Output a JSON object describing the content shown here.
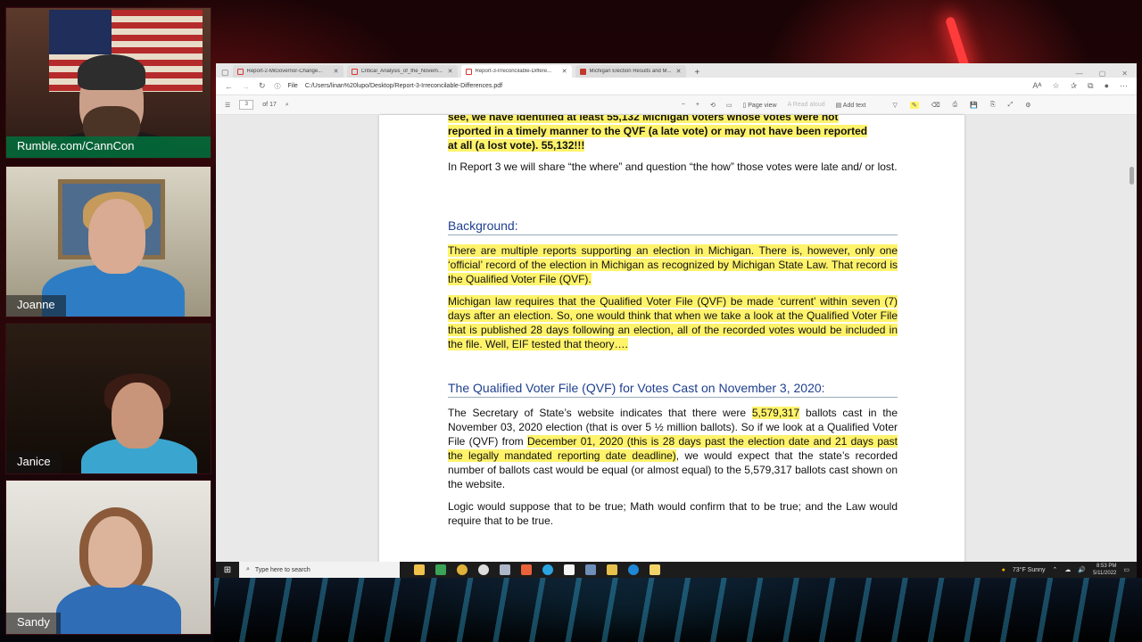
{
  "webcams": [
    {
      "name": "Rumble.com/CannCon"
    },
    {
      "name": "Joanne"
    },
    {
      "name": "Janice"
    },
    {
      "name": "Sandy"
    }
  ],
  "browser": {
    "tabs": [
      {
        "title": "Report-2-MiGovernor-Change..."
      },
      {
        "title": "Critical_Analysis_of_the_Novem..."
      },
      {
        "title": "Report-3-Irreconcilable-Differe..."
      },
      {
        "title": "Michigan Election Results and M..."
      }
    ],
    "address": {
      "file_label": "File",
      "url": "C:/Users/linan%20lupo/Desktop/Report-3-Irreconcilable-Differences.pdf"
    },
    "pdf_toolbar": {
      "page_current": "3",
      "page_total": "of 17",
      "page_view": "Page view",
      "read_aloud": "Read aloud",
      "add_text": "Add text"
    }
  },
  "document": {
    "intro_lines": [
      "see, we have identified at least 55,132 Michigan voters whose votes were not",
      "reported in a timely manner to the QVF (a late vote) or may not have been reported",
      "at all (a lost vote).  55,132!!!"
    ],
    "report3_para": "In Report 3 we will share “the where” and question “the how” those votes were late and/ or lost.",
    "background_heading": "Background:",
    "background_p1": "There are multiple reports supporting an election in Michigan.  There is, however, only one ‘official’ record of the election in Michigan as recognized by Michigan State Law.  That record is the Qualified Voter File (QVF).",
    "background_p2": "Michigan law requires that the Qualified Voter File (QVF) be made ‘current’ within seven (7) days after an election.  So, one would think that when we take a look at the Qualified Voter File that is published 28 days following an election, all of the recorded votes would be included in the file.  Well, EIF tested that theory….",
    "qvf_heading": "The Qualified Voter File (QVF) for Votes Cast on November 3, 2020:",
    "qvf_p1_a": "The Secretary of State’s website indicates that there were ",
    "qvf_p1_num": "5,579,317",
    "qvf_p1_b": " ballots cast in the November 03, 2020 election (that is over 5 ½ million ballots).  So if we look at a Qualified Voter File (QVF) from ",
    "qvf_p1_hl": "December 01, 2020 (this is 28 days past the election date and 21 days past the legally mandated reporting date deadline)",
    "qvf_p1_c": ", we would expect that the state’s recorded number of ballots cast would be equal (or almost equal) to the 5,579,317 ballots cast shown on the website.",
    "logic_p": "Logic would suppose that to be true; Math would confirm that to be true; and the Law would require that to be true."
  },
  "taskbar": {
    "search_placeholder": "Type here to search",
    "weather": "73°F  Sunny",
    "time": "8:53 PM",
    "date": "5/11/2022"
  }
}
